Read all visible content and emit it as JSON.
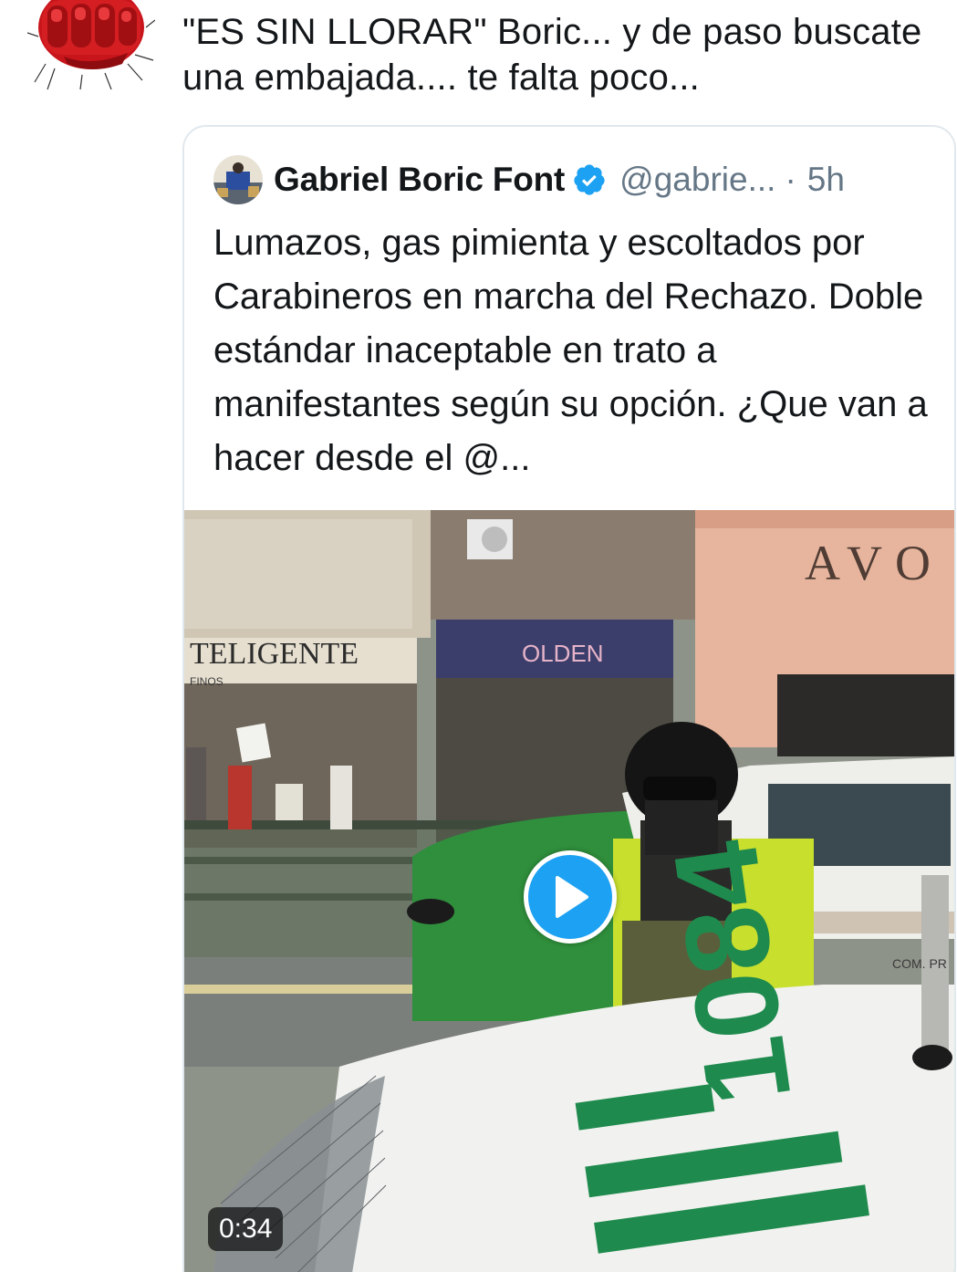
{
  "tweet": {
    "text": "\"ES SIN LLORAR\" Boric... y de paso buscate una embajada.... te falta poco..."
  },
  "quote": {
    "author_name": "Gabriel Boric Font",
    "handle": "@gabrie...",
    "separator": "·",
    "time": "5h",
    "text": "Lumazos, gas pimienta y escoltados por Carabineros en marcha del Rechazo. Doble estándar inaceptable en trato a manifestantes según su opción. ¿Que van a hacer desde el @..."
  },
  "media": {
    "duration": "0:34",
    "signs": {
      "store_left": "TELIGENTE",
      "store_left_sub": "FINOS",
      "store_mid": "OLDEN",
      "store_right": "AVO",
      "car_number": "1084",
      "window_text": "COM. PR"
    }
  },
  "colors": {
    "accent": "#1da1f2",
    "text": "#14171a",
    "secondary": "#657786",
    "border": "#e1e8ed"
  },
  "icons": {
    "verified": "verified-badge-icon",
    "play": "play-icon"
  }
}
